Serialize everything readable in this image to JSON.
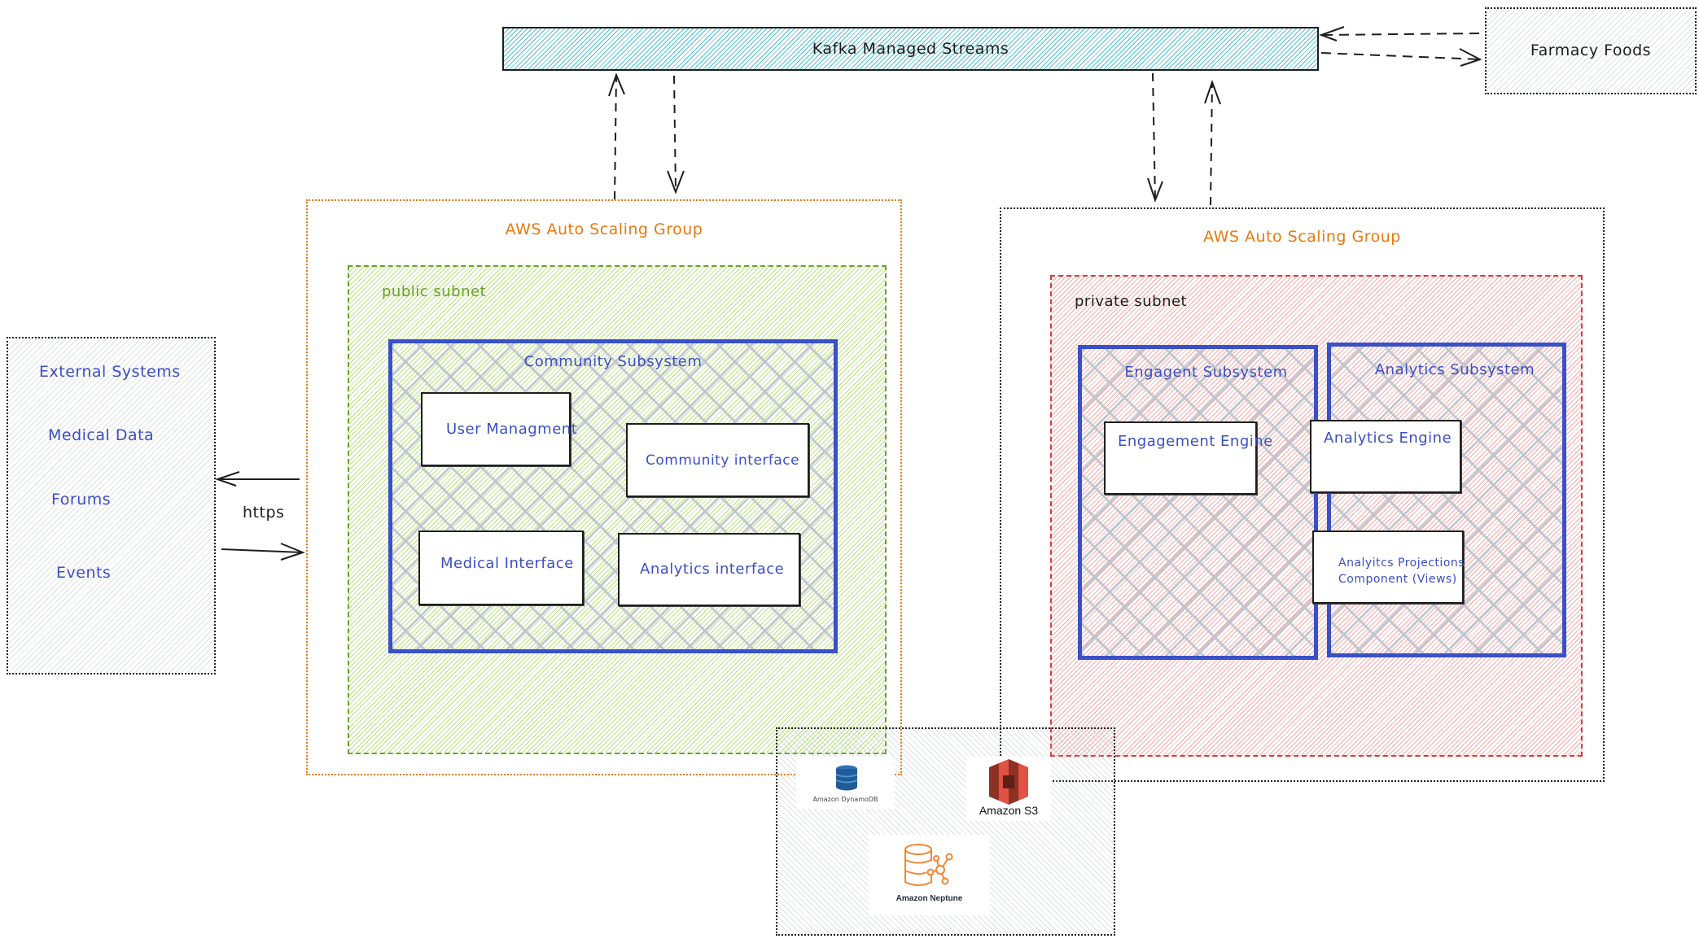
{
  "diagram": {
    "kafka": {
      "label": "Kafka Managed Streams"
    },
    "farmacy": {
      "label": "Farmacy Foods"
    },
    "external_systems": {
      "items": [
        "External Systems",
        "Medical Data",
        "Forums",
        "Events"
      ]
    },
    "https_label": "https",
    "asg_left": {
      "title": "AWS Auto Scaling Group",
      "subnet": {
        "label": "public subnet",
        "subsystem": {
          "title": "Community Subsystem",
          "components": [
            "User Managment",
            "Community interface",
            "Medical Interface",
            "Analytics interface"
          ]
        }
      }
    },
    "asg_right": {
      "title": "AWS Auto Scaling Group",
      "subnet": {
        "label": "private subnet",
        "subsystems": [
          {
            "title": "Engagent Subsystem",
            "components": [
              "Engagement Engine"
            ]
          },
          {
            "title": "Analytics Subsystem",
            "components": [
              "Analytics Engine",
              "Analyitcs Projections",
              "Component (Views)"
            ]
          }
        ]
      }
    },
    "storage": {
      "services": [
        {
          "name": "Amazon DynamoDB",
          "icon": "dynamodb-icon"
        },
        {
          "name": "Amazon S3",
          "icon": "s3-icon"
        },
        {
          "name": "Amazon Neptune",
          "icon": "neptune-icon"
        }
      ]
    },
    "colors": {
      "blue_text": "#3b4fc4",
      "orange": "#e8790e",
      "green": "#6aa12a",
      "red": "#d93a3a",
      "cyan": "#15aabf",
      "subsystem_border": "#3a50c8"
    }
  }
}
